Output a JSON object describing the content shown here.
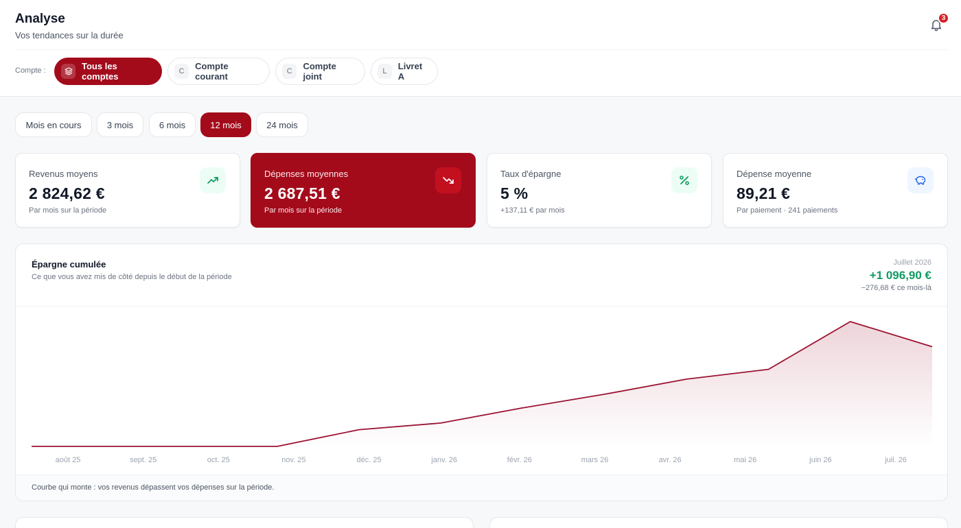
{
  "header": {
    "title": "Analyse",
    "subtitle": "Vos tendances sur la durée",
    "notifications_count": "3"
  },
  "accounts": {
    "label": "Compte :",
    "items": [
      {
        "letter": "",
        "label": "Tous les comptes",
        "active": true
      },
      {
        "letter": "C",
        "label": "Compte courant",
        "active": false
      },
      {
        "letter": "C",
        "label": "Compte joint",
        "active": false
      },
      {
        "letter": "L",
        "label": "Livret A",
        "active": false
      }
    ]
  },
  "periods": {
    "items": [
      {
        "label": "Mois en cours",
        "active": false
      },
      {
        "label": "3 mois",
        "active": false
      },
      {
        "label": "6 mois",
        "active": false
      },
      {
        "label": "12 mois",
        "active": true
      },
      {
        "label": "24 mois",
        "active": false
      }
    ]
  },
  "kpis": [
    {
      "label": "Revenus moyens",
      "value": "2 824,62 €",
      "sub": "Par mois sur la période",
      "icon": "trend-up-icon",
      "icon_color": "#0f9b63",
      "icon_bg": "#ecfdf5",
      "active": false
    },
    {
      "label": "Dépenses moyennes",
      "value": "2 687,51 €",
      "sub": "Par mois sur la période",
      "icon": "trend-down-icon",
      "icon_color": "#ffffff",
      "icon_bg": "#c3101f",
      "active": true
    },
    {
      "label": "Taux d'épargne",
      "value": "5 %",
      "sub": "+137,11 € par mois",
      "icon": "percent-icon",
      "icon_color": "#0f9b63",
      "icon_bg": "#ecfdf5",
      "active": false
    },
    {
      "label": "Dépense moyenne",
      "value": "89,21 €",
      "sub": "Par paiement · 241 paiements",
      "icon": "piggy-bank-icon",
      "icon_color": "#2563eb",
      "icon_bg": "#eff6ff",
      "active": false
    }
  ],
  "chart": {
    "title": "Épargne cumulée",
    "subtitle": "Ce que vous avez mis de côté depuis le début de la période",
    "month": "Juillet 2026",
    "total": "+1 096,90 €",
    "delta": "−276,68 € ce mois-là",
    "note": "Courbe qui monte : vos revenus dépassent vos dépenses sur la période.",
    "line_color": "#9b1230"
  },
  "chart_data": {
    "type": "area",
    "title": "Épargne cumulée",
    "categories": [
      "août 25",
      "sept. 25",
      "oct. 25",
      "nov. 25",
      "déc. 25",
      "janv. 26",
      "févr. 26",
      "mars 26",
      "avr. 26",
      "mai 26",
      "juin 26",
      "juil. 26"
    ],
    "values": [
      0,
      0,
      0,
      0,
      184,
      257,
      424,
      574,
      740,
      848,
      1373,
      1097
    ],
    "ylim": [
      0,
      1373
    ],
    "grid": false
  }
}
